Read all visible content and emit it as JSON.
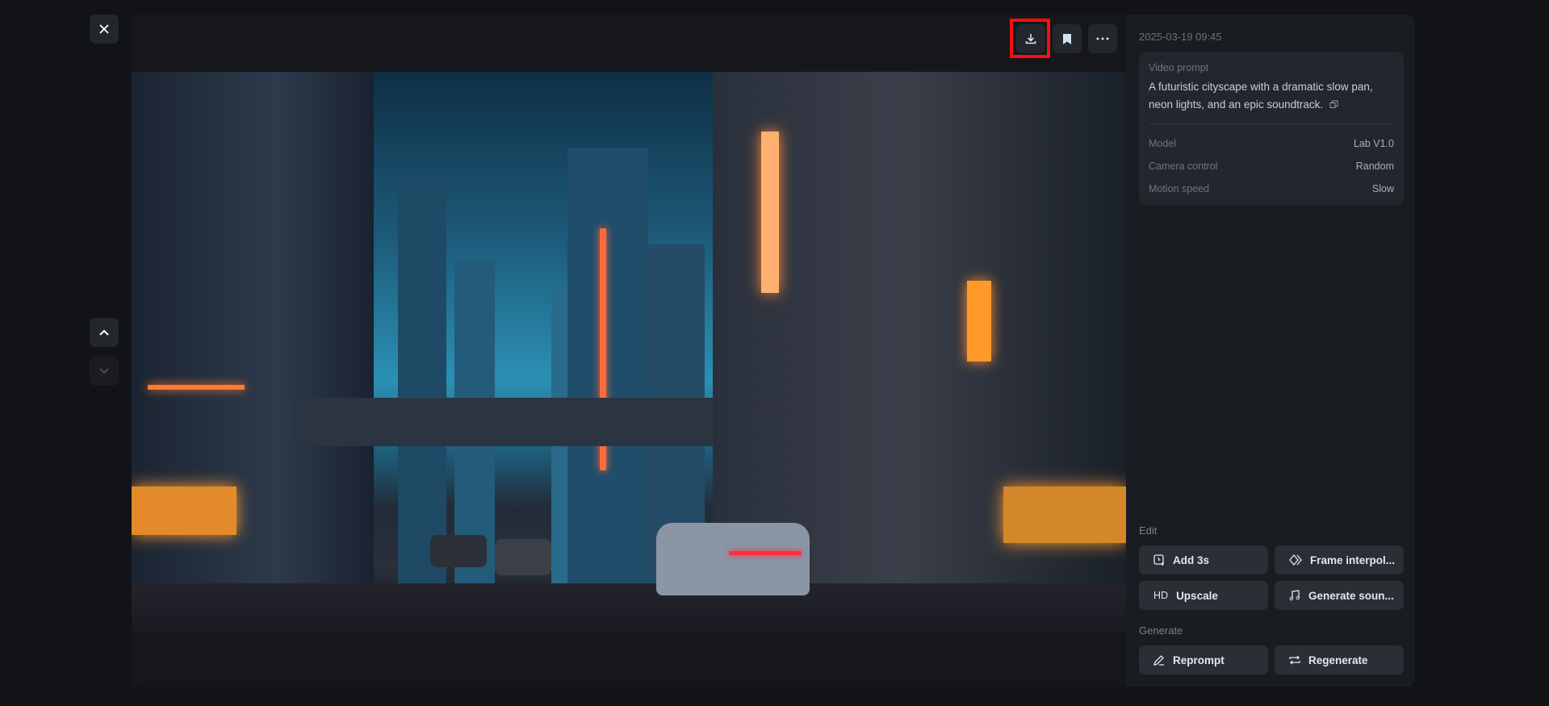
{
  "toolbar": {
    "close_icon": "close-icon",
    "download_icon": "download-icon",
    "bookmark_icon": "bookmark-icon",
    "more_icon": "more-icon"
  },
  "nav": {
    "prev_icon": "chevron-up-icon",
    "next_icon": "chevron-down-icon"
  },
  "details": {
    "timestamp": "2025-03-19 09:45",
    "prompt_label": "Video prompt",
    "prompt_text": "A futuristic cityscape with a dramatic slow pan, neon lights, and an epic soundtrack.",
    "props": [
      {
        "label": "Model",
        "value": "Lab V1.0"
      },
      {
        "label": "Camera control",
        "value": "Random"
      },
      {
        "label": "Motion speed",
        "value": "Slow"
      }
    ]
  },
  "edit": {
    "title": "Edit",
    "add": "Add 3s",
    "interp": "Frame interpol...",
    "upscale_badge": "HD",
    "upscale": "Upscale",
    "sound": "Generate soun..."
  },
  "generate": {
    "title": "Generate",
    "reprompt": "Reprompt",
    "regenerate": "Regenerate"
  },
  "colors": {
    "highlight": "#ff0d0d",
    "panel": "#191c21",
    "button": "#2a2e35"
  }
}
